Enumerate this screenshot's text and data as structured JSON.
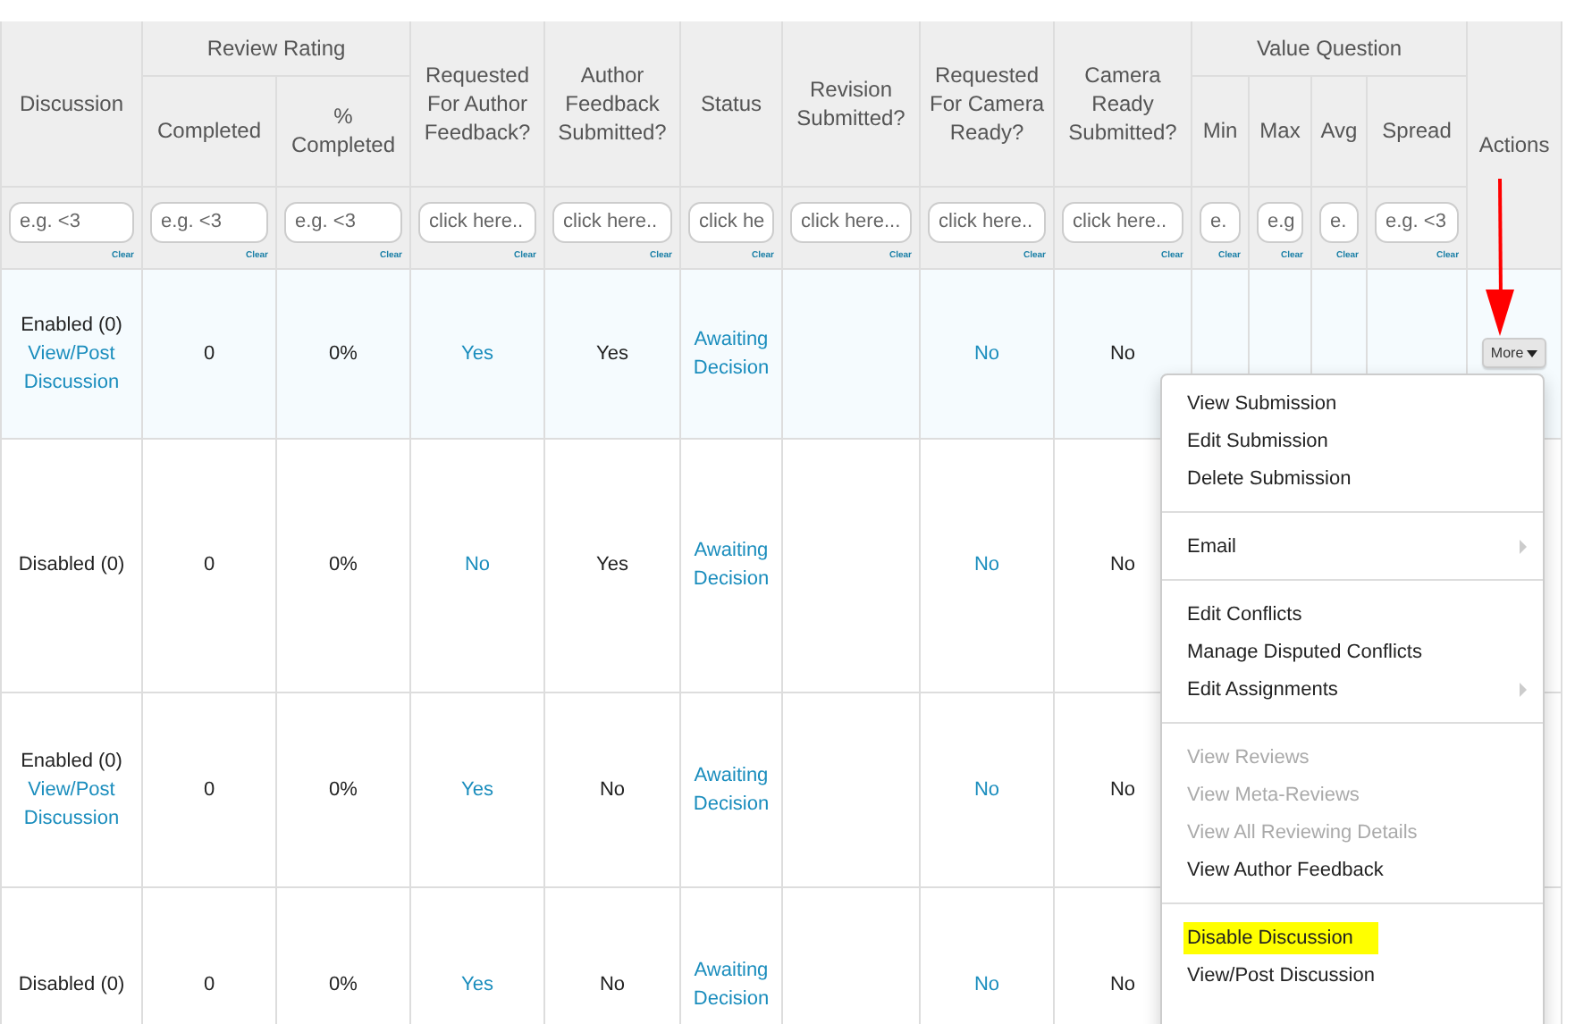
{
  "table": {
    "header_groups": [
      {
        "kind": "column",
        "label": "Discussion"
      },
      {
        "kind": "group",
        "label": "Review Rating",
        "sub_columns": [
          "Completed",
          "% Completed"
        ]
      },
      {
        "kind": "column",
        "label": "Requested For Author Feedback?"
      },
      {
        "kind": "column",
        "label": "Author Feedback Submitted?"
      },
      {
        "kind": "column",
        "label": "Status"
      },
      {
        "kind": "column",
        "label": "Revision Submitted?"
      },
      {
        "kind": "column",
        "label": "Requested For Camera Ready?"
      },
      {
        "kind": "column",
        "label": "Camera Ready Submitted?"
      },
      {
        "kind": "group",
        "label": "Value Question",
        "sub_columns": [
          "Min",
          "Max",
          "Avg",
          "Spread"
        ]
      },
      {
        "kind": "actions",
        "label": "Actions"
      }
    ],
    "filters": [
      {
        "placeholder": "e.g. <3",
        "clear": "Clear"
      },
      {
        "placeholder": "e.g. <3",
        "clear": "Clear"
      },
      {
        "placeholder": "e.g. <3",
        "clear": "Clear"
      },
      {
        "placeholder": "click here..",
        "clear": "Clear"
      },
      {
        "placeholder": "click here..",
        "clear": "Clear"
      },
      {
        "placeholder": "click he",
        "clear": "Clear"
      },
      {
        "placeholder": "click here...",
        "clear": "Clear"
      },
      {
        "placeholder": "click here..",
        "clear": "Clear"
      },
      {
        "placeholder": "click here..",
        "clear": "Clear"
      },
      {
        "placeholder": "e.",
        "clear": "Clear"
      },
      {
        "placeholder": "e.g",
        "clear": "Clear"
      },
      {
        "placeholder": "e.",
        "clear": "Clear"
      },
      {
        "placeholder": "e.g. <3",
        "clear": "Clear"
      }
    ],
    "rows": [
      {
        "selected": true,
        "discussion": "Enabled (0)",
        "discussion_link": "View/Post Discussion",
        "completed": "0",
        "pct_completed": "0%",
        "requested_author_feedback": "Yes",
        "author_feedback_submitted": "Yes",
        "status": "Awaiting Decision",
        "requested_camera_ready": "No",
        "camera_ready_submitted": "No",
        "action": "More"
      },
      {
        "selected": false,
        "discussion": "Disabled (0)",
        "completed": "0",
        "pct_completed": "0%",
        "requested_author_feedback": "No",
        "author_feedback_submitted": "Yes",
        "status": "Awaiting Decision",
        "requested_camera_ready": "No",
        "camera_ready_submitted": "No"
      },
      {
        "selected": false,
        "discussion": "Enabled (0)",
        "discussion_link": "View/Post Discussion",
        "completed": "0",
        "pct_completed": "0%",
        "requested_author_feedback": "Yes",
        "author_feedback_submitted": "No",
        "status": "Awaiting Decision",
        "requested_camera_ready": "No",
        "camera_ready_submitted": "No"
      },
      {
        "selected": false,
        "discussion": "Disabled (0)",
        "completed": "0",
        "pct_completed": "0%",
        "requested_author_feedback": "Yes",
        "author_feedback_submitted": "No",
        "status": "Awaiting Decision",
        "requested_camera_ready": "No",
        "camera_ready_submitted": "No"
      }
    ]
  },
  "menu": {
    "groups": [
      [
        {
          "label": "View Submission",
          "disabled": false,
          "submenu": false,
          "highlighted": false
        },
        {
          "label": "Edit Submission",
          "disabled": false,
          "submenu": false,
          "highlighted": false
        },
        {
          "label": "Delete Submission",
          "disabled": false,
          "submenu": false,
          "highlighted": false
        }
      ],
      [
        {
          "label": "Email",
          "disabled": false,
          "submenu": true,
          "highlighted": false
        }
      ],
      [
        {
          "label": "Edit Conflicts",
          "disabled": false,
          "submenu": false,
          "highlighted": false
        },
        {
          "label": "Manage Disputed Conflicts",
          "disabled": false,
          "submenu": false,
          "highlighted": false
        },
        {
          "label": "Edit Assignments",
          "disabled": false,
          "submenu": true,
          "highlighted": false
        }
      ],
      [
        {
          "label": "View Reviews",
          "disabled": true,
          "submenu": false,
          "highlighted": false
        },
        {
          "label": "View Meta-Reviews",
          "disabled": true,
          "submenu": false,
          "highlighted": false
        },
        {
          "label": "View All Reviewing Details",
          "disabled": true,
          "submenu": false,
          "highlighted": false
        },
        {
          "label": "View Author Feedback",
          "disabled": false,
          "submenu": false,
          "highlighted": false
        }
      ],
      [
        {
          "label": "Disable Discussion",
          "disabled": false,
          "submenu": false,
          "highlighted": true
        },
        {
          "label": "View/Post Discussion",
          "disabled": false,
          "submenu": false,
          "highlighted": false
        }
      ]
    ]
  }
}
